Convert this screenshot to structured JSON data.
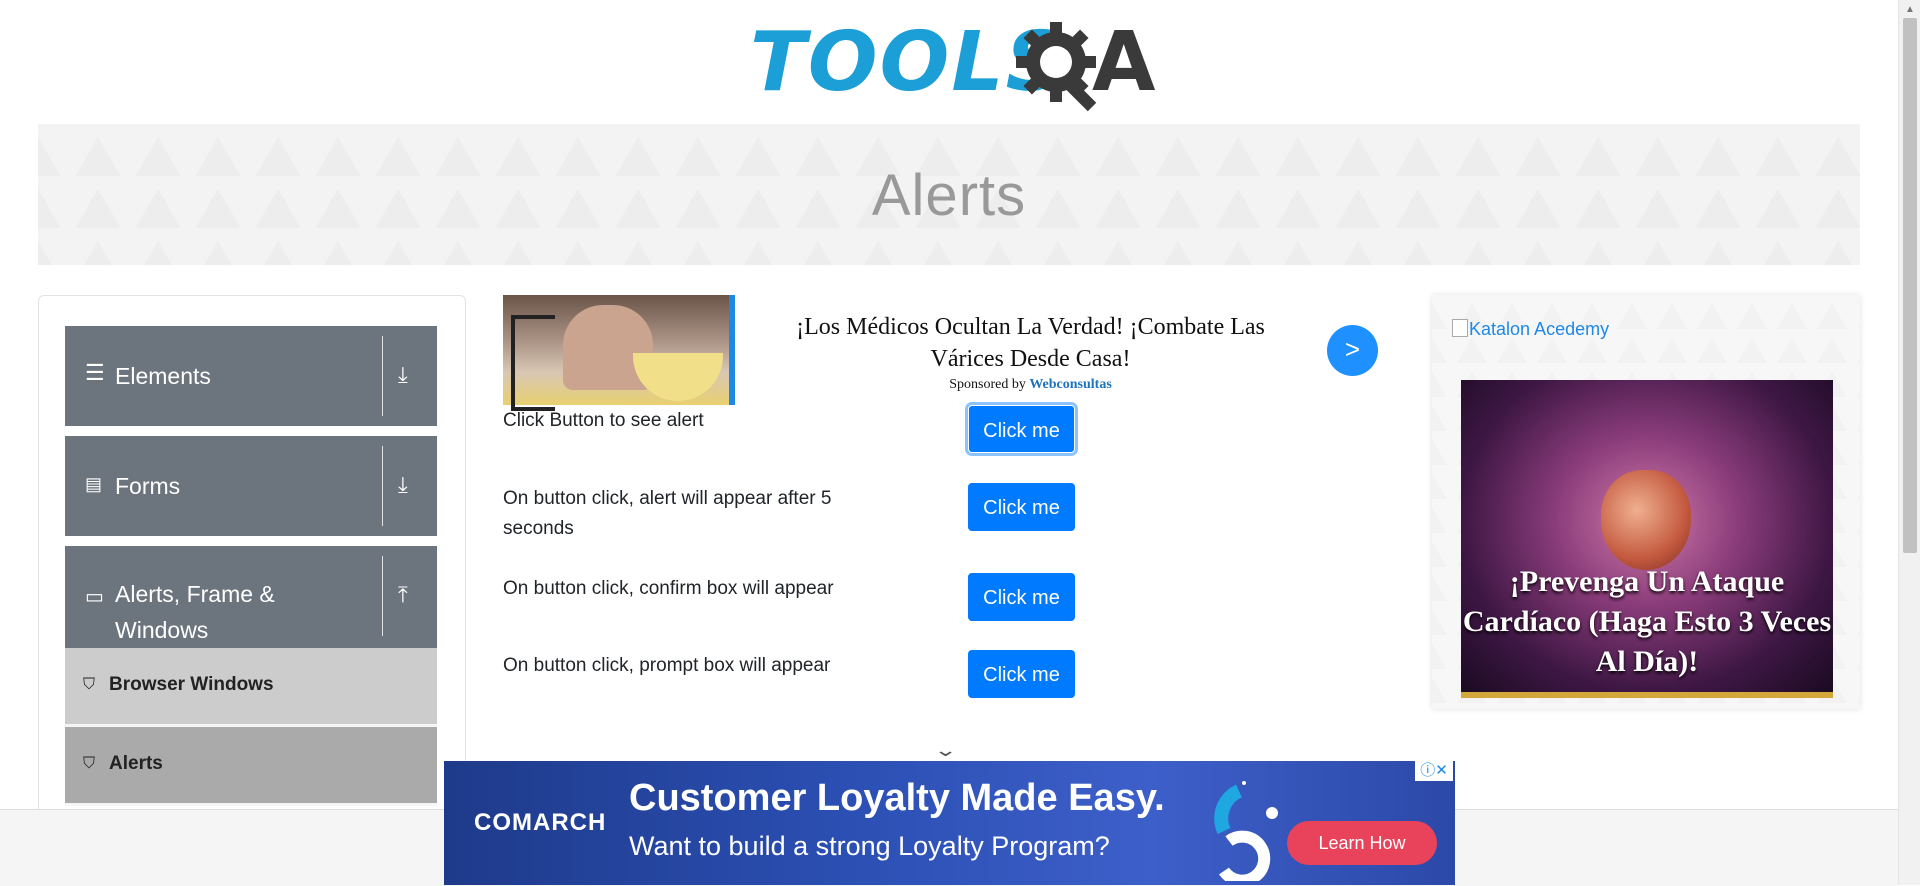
{
  "header": {
    "logo_text": "TOOLS",
    "logo_qa": "A",
    "logo_gear_icon": "gear-magnifier-icon",
    "page_title": "Alerts"
  },
  "sidebar": {
    "groups": [
      {
        "label": "Elements",
        "icon": "hamburger-icon",
        "arrow": "download-arrow-icon"
      },
      {
        "label": "Forms",
        "icon": "document-icon",
        "arrow": "download-arrow-icon"
      },
      {
        "label": "Alerts, Frame & Windows",
        "icon": "window-icon",
        "arrow": "upload-arrow-icon"
      }
    ],
    "items": [
      {
        "label": "Browser Windows",
        "icon": "html5-icon",
        "active": false
      },
      {
        "label": "Alerts",
        "icon": "html5-icon",
        "active": true
      }
    ]
  },
  "ad_top": {
    "headline": "¡Los Médicos Ocultan La Verdad! ¡Combate Las Várices Desde Casa!",
    "sponsored_prefix": "Sponsored by",
    "sponsor": "Webconsultas",
    "arrow": ">"
  },
  "alerts": [
    {
      "label": "Click Button to see alert",
      "button": "Click me"
    },
    {
      "label": "On button click, alert will appear after 5 seconds",
      "button": "Click me"
    },
    {
      "label": "On button click, confirm box will appear",
      "button": "Click me"
    },
    {
      "label": "On button click, prompt box will appear",
      "button": "Click me"
    }
  ],
  "ad_right": {
    "image_alt": "Katalon Acedemy",
    "headline": "¡Prevenga Un Ataque Cardíaco (Haga Esto 3 Veces Al Día)!"
  },
  "ad_bottom": {
    "brand": "COMARCH",
    "headline": "Customer Loyalty Made Easy.",
    "subline": "Want to build a strong Loyalty Program?",
    "cta": "Learn How",
    "adchoices": "ⓘ✕"
  },
  "colors": {
    "primary_button": "#007bff",
    "sidebar_group": "#6c757d",
    "sidebar_item": "#cccccc",
    "sidebar_item_active": "#aaaaaa",
    "logo_blue": "#1b9fd6"
  }
}
